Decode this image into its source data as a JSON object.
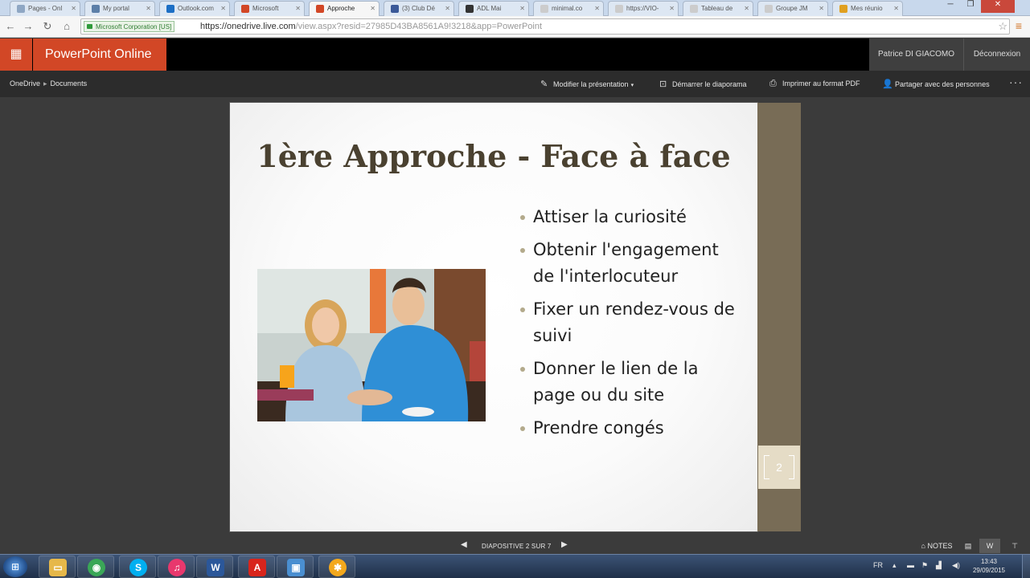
{
  "browser": {
    "tabs": [
      {
        "label": "Pages - Onl",
        "color": "#8fa7c4"
      },
      {
        "label": "My portal",
        "color": "#5c7fa8"
      },
      {
        "label": "Outlook.com",
        "color": "#1d6fc5"
      },
      {
        "label": "Microsoft",
        "color": "#d24726"
      },
      {
        "label": "Approche",
        "color": "#d24726"
      },
      {
        "label": "(3) Club Dé",
        "color": "#3b5998"
      },
      {
        "label": "ADL Mai",
        "color": "#333333"
      },
      {
        "label": "minimal.co",
        "color": "#cccccc"
      },
      {
        "label": "https://VIO-",
        "color": "#cccccc"
      },
      {
        "label": "Tableau de",
        "color": "#cccccc"
      },
      {
        "label": "Groupe JM",
        "color": "#cccccc"
      },
      {
        "label": "Mes réunio",
        "color": "#e0a020"
      }
    ],
    "ev_label": "Microsoft Corporation [US]",
    "url_main": "https://onedrive.live.com",
    "url_rest": "/view.aspx?resid=27985D43BA8561A9!3218&app=PowerPoint"
  },
  "header": {
    "app_name": "PowerPoint Online",
    "user_name": "Patrice DI GIACOMO",
    "logout_label": "Déconnexion"
  },
  "commandbar": {
    "breadcrumb_root": "OneDrive",
    "breadcrumb_folder": "Documents",
    "edit_label": "Modifier la présentation",
    "slideshow_label": "Démarrer le diaporama",
    "print_label": "Imprimer au format PDF",
    "share_label": "Partager avec des personnes",
    "more_label": "···"
  },
  "slide": {
    "title": "1ère Approche - Face à face",
    "bullets": [
      "Attiser la curiosité",
      "Obtenir l'engagement de l'interlocuteur",
      "Fixer un rendez-vous de suivi",
      "Donner le lien de la page ou du site",
      "Prendre congés"
    ],
    "number": "2"
  },
  "footer": {
    "counter": "DIAPOSITIVE 2 SUR 7",
    "notes_label": "NOTES"
  },
  "taskbar": {
    "start_icon": "windows-logo",
    "apps": [
      {
        "name": "explorer",
        "color": "#e6b84a",
        "glyph": "▭"
      },
      {
        "name": "chrome",
        "color": "#3aa757",
        "glyph": "◉"
      },
      {
        "name": "skype",
        "color": "#00aff0",
        "glyph": "S"
      },
      {
        "name": "itunes",
        "color": "#e8386d",
        "glyph": "♫"
      },
      {
        "name": "word",
        "color": "#2b579a",
        "glyph": "W"
      },
      {
        "name": "acrobat",
        "color": "#d8251c",
        "glyph": "A"
      },
      {
        "name": "remote-desktop",
        "color": "#4a8fd1",
        "glyph": "▣"
      },
      {
        "name": "starburst",
        "color": "#f3a81c",
        "glyph": "✱"
      }
    ],
    "lang": "FR",
    "time": "13:43",
    "date": "29/09/2015"
  }
}
